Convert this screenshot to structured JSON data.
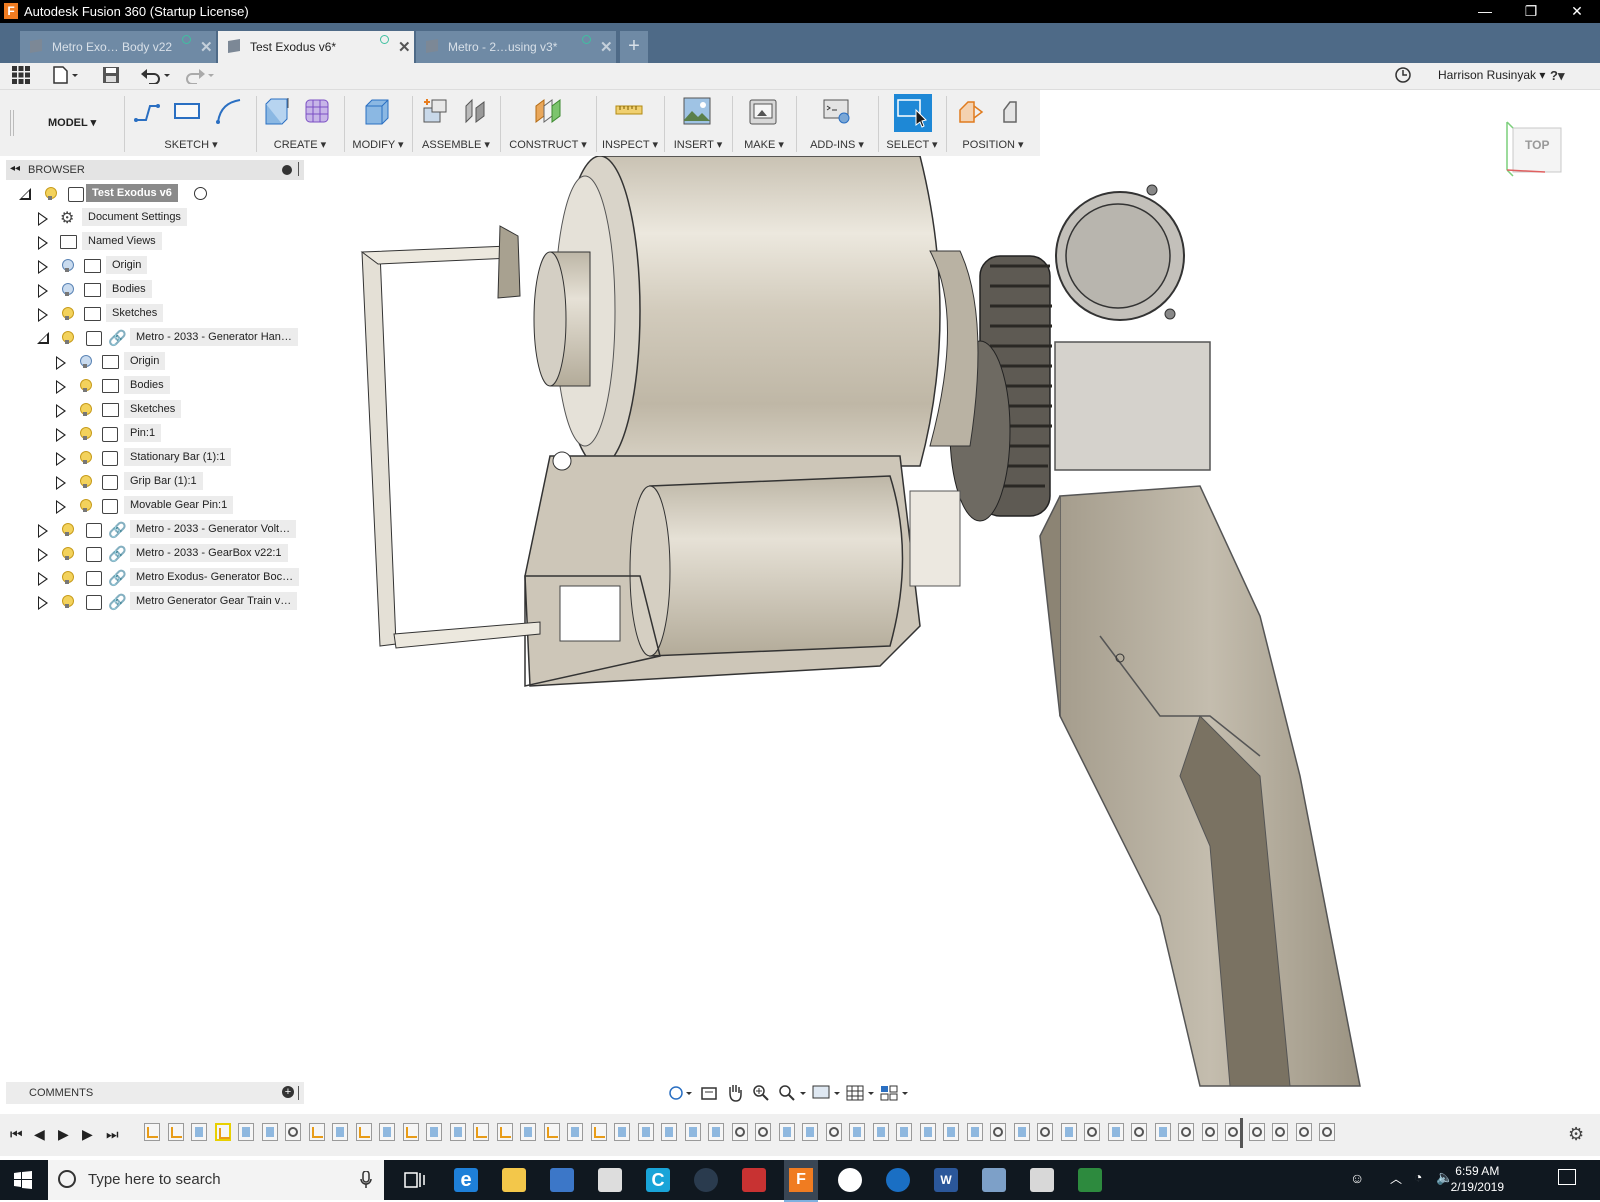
{
  "window": {
    "title": "Autodesk Fusion 360 (Startup License)",
    "logo_letter": "F",
    "minimize": "—",
    "maximize": "❐",
    "close": "✕"
  },
  "tabs": [
    {
      "label": "Metro Exo… Body v22",
      "active": false
    },
    {
      "label": "Test Exodus v6*",
      "active": true
    },
    {
      "label": "Metro - 2…using v3*",
      "active": false
    }
  ],
  "new_tab": "+",
  "user": {
    "name": "Harrison Rusinyak ▾",
    "help": "?▾"
  },
  "toolbar": {
    "workspace": "MODEL ▾",
    "groups": [
      {
        "label": "SKETCH ▾"
      },
      {
        "label": "CREATE ▾"
      },
      {
        "label": "MODIFY ▾"
      },
      {
        "label": "ASSEMBLE ▾"
      },
      {
        "label": "CONSTRUCT ▾"
      },
      {
        "label": "INSPECT ▾"
      },
      {
        "label": "INSERT ▾"
      },
      {
        "label": "MAKE ▾"
      },
      {
        "label": "ADD-INS ▾"
      },
      {
        "label": "SELECT ▾"
      },
      {
        "label": "POSITION ▾"
      }
    ]
  },
  "browser": {
    "title": "BROWSER",
    "collapse": "◂◂",
    "rows": [
      {
        "label": "Test Exodus v6",
        "root": true
      },
      {
        "label": "Document Settings"
      },
      {
        "label": "Named Views"
      },
      {
        "label": "Origin"
      },
      {
        "label": "Bodies"
      },
      {
        "label": "Sketches"
      },
      {
        "label": "Metro - 2033 - Generator Han…"
      },
      {
        "label": "Origin"
      },
      {
        "label": "Bodies"
      },
      {
        "label": "Sketches"
      },
      {
        "label": "Pin:1"
      },
      {
        "label": "Stationary Bar (1):1"
      },
      {
        "label": "Grip Bar (1):1"
      },
      {
        "label": "Movable Gear Pin:1"
      },
      {
        "label": "Metro - 2033 - Generator Volt…"
      },
      {
        "label": "Metro - 2033 - GearBox v22:1"
      },
      {
        "label": "Metro Exodus- Generator Boc…"
      },
      {
        "label": "Metro Generator Gear Train v…"
      }
    ]
  },
  "comments": {
    "title": "COMMENTS",
    "add": "+"
  },
  "viewcube": {
    "label": "TOP"
  },
  "taskbar": {
    "search_placeholder": "Type here to search",
    "time": "6:59 AM",
    "date": "2/19/2019"
  },
  "colors": {
    "title_bar": "#000000",
    "tab_strip": "#4e6a87",
    "toolbar": "#f0f0f0",
    "select_active": "#1e88d6",
    "taskbar": "#101820"
  }
}
